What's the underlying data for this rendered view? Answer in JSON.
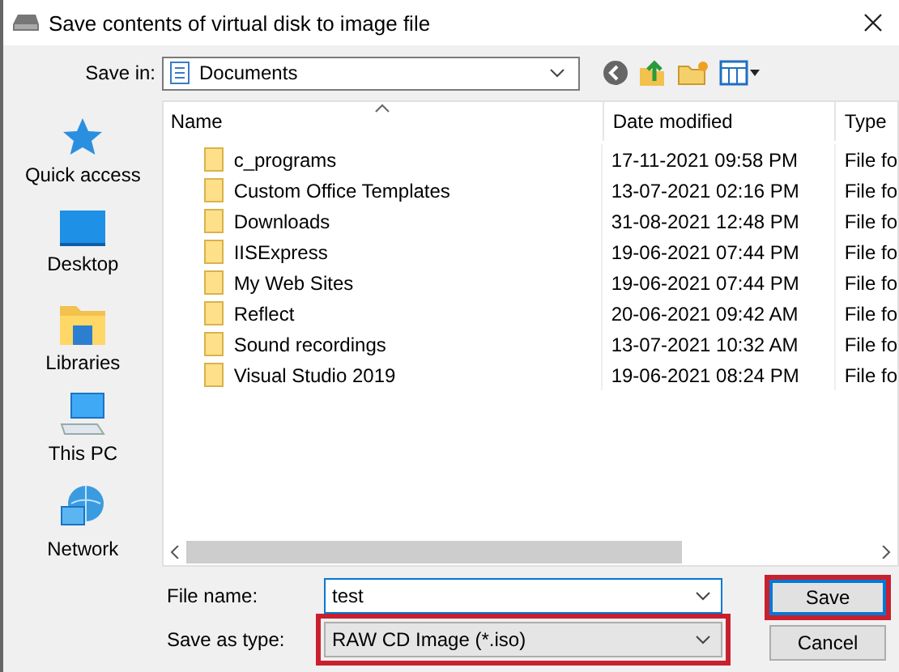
{
  "window": {
    "title": "Save contents of virtual disk to image file"
  },
  "save_in": {
    "label": "Save in:",
    "value": "Documents"
  },
  "places": [
    {
      "kind": "quick-access",
      "label": "Quick access"
    },
    {
      "kind": "desktop",
      "label": "Desktop"
    },
    {
      "kind": "libraries",
      "label": "Libraries"
    },
    {
      "kind": "this-pc",
      "label": "This PC"
    },
    {
      "kind": "network",
      "label": "Network"
    }
  ],
  "table": {
    "columns": [
      "Name",
      "Date modified",
      "Type"
    ],
    "rows": [
      {
        "name": "c_programs",
        "date": "17-11-2021 09:58 PM",
        "type": "File fo"
      },
      {
        "name": "Custom Office Templates",
        "date": "13-07-2021 02:16 PM",
        "type": "File fo"
      },
      {
        "name": "Downloads",
        "date": "31-08-2021 12:48 PM",
        "type": "File fo"
      },
      {
        "name": "IISExpress",
        "date": "19-06-2021 07:44 PM",
        "type": "File fo"
      },
      {
        "name": "My Web Sites",
        "date": "19-06-2021 07:44 PM",
        "type": "File fo"
      },
      {
        "name": "Reflect",
        "date": "20-06-2021 09:42 AM",
        "type": "File fo"
      },
      {
        "name": "Sound recordings",
        "date": "13-07-2021 10:32 AM",
        "type": "File fo"
      },
      {
        "name": "Visual Studio 2019",
        "date": "19-06-2021 08:24 PM",
        "type": "File fo"
      }
    ]
  },
  "file_name": {
    "label": "File name:",
    "value": "test",
    "highlighted": false
  },
  "save_as_type": {
    "label": "Save as type:",
    "value": "RAW CD Image (*.iso)",
    "highlighted": true
  },
  "buttons": [
    {
      "label": "Save",
      "highlighted": true
    },
    {
      "label": "Cancel",
      "highlighted": false
    }
  ]
}
